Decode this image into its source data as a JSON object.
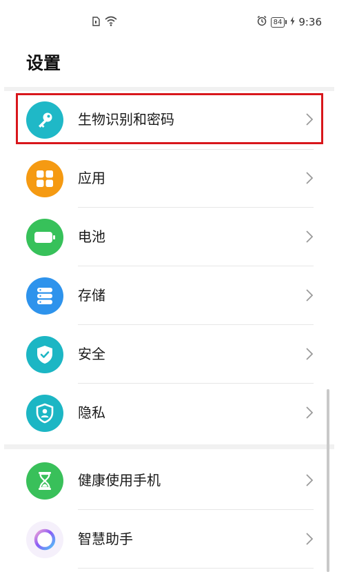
{
  "status_bar": {
    "left_icons": [
      "sim-icon",
      "wifi-icon"
    ],
    "alarm_icon": "alarm-icon",
    "battery_level": "84",
    "charging_icon": "bolt-icon",
    "time": "9:36"
  },
  "page": {
    "title": "设置"
  },
  "settings": {
    "items": [
      {
        "label": "生物识别和密码",
        "icon": "key-icon",
        "color": "#1fb8c7"
      },
      {
        "label": "应用",
        "icon": "apps-grid-icon",
        "color": "#f59a12"
      },
      {
        "label": "电池",
        "icon": "battery-icon",
        "color": "#37c15a"
      },
      {
        "label": "存储",
        "icon": "storage-icon",
        "color": "#2e93ec"
      },
      {
        "label": "安全",
        "icon": "shield-check-icon",
        "color": "#1cb6c4"
      },
      {
        "label": "隐私",
        "icon": "privacy-shield-icon",
        "color": "#1cb6c4"
      },
      {
        "label": "健康使用手机",
        "icon": "hourglass-icon",
        "color": "#39c05a"
      },
      {
        "label": "智慧助手",
        "icon": "assistant-ring-icon",
        "color": "#8b5cf6"
      }
    ]
  },
  "colors": {
    "highlight": "#d8161b"
  }
}
